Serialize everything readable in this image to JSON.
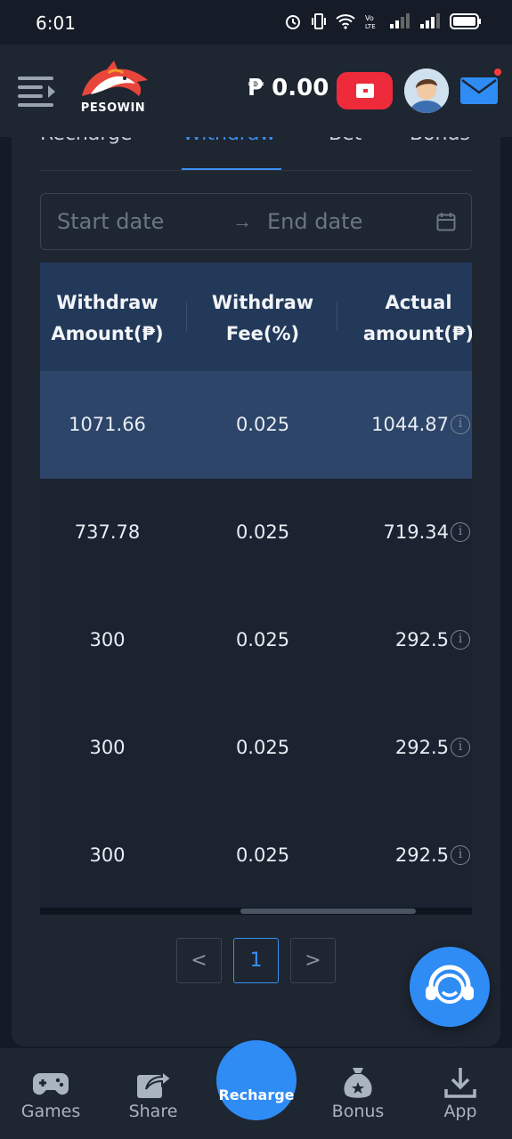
{
  "status_bar": {
    "time": "6:01"
  },
  "header": {
    "logo_text": "PESOWIN",
    "balance": "₱ 0.00"
  },
  "tabs": [
    {
      "label": "Recharge"
    },
    {
      "label": "Withdraw",
      "active": true
    },
    {
      "label": "Bet"
    },
    {
      "label": "Bonus"
    }
  ],
  "date_range": {
    "start_placeholder": "Start date",
    "arrow": "→",
    "end_placeholder": "End date"
  },
  "table": {
    "headers": [
      "Withdraw Amount(₱)",
      "Withdraw Fee(%)",
      "Actual amount(₱)"
    ],
    "header_lines": [
      [
        "Withdraw",
        "Amount(₱)"
      ],
      [
        "Withdraw",
        "Fee(%)"
      ],
      [
        "Actual",
        "amount(₱)"
      ]
    ],
    "rows": [
      {
        "amount": "1071.66",
        "fee": "0.025",
        "actual": "1044.87"
      },
      {
        "amount": "737.78",
        "fee": "0.025",
        "actual": "719.34"
      },
      {
        "amount": "300",
        "fee": "0.025",
        "actual": "292.5"
      },
      {
        "amount": "300",
        "fee": "0.025",
        "actual": "292.5"
      },
      {
        "amount": "300",
        "fee": "0.025",
        "actual": "292.5"
      }
    ]
  },
  "pagination": {
    "prev": "<",
    "current": "1",
    "next": ">"
  },
  "bottom_nav": [
    {
      "label": "Games",
      "icon": "gamepad-icon"
    },
    {
      "label": "Share",
      "icon": "share-icon"
    },
    {
      "label": "Recharge",
      "icon": "recharge-button"
    },
    {
      "label": "Bonus",
      "icon": "money-bag-icon"
    },
    {
      "label": "App",
      "icon": "download-icon"
    }
  ],
  "colors": {
    "accent": "#2f8cf5",
    "wallet_red": "#ee2b3b",
    "background": "#141b26",
    "panel": "#1e2632"
  }
}
